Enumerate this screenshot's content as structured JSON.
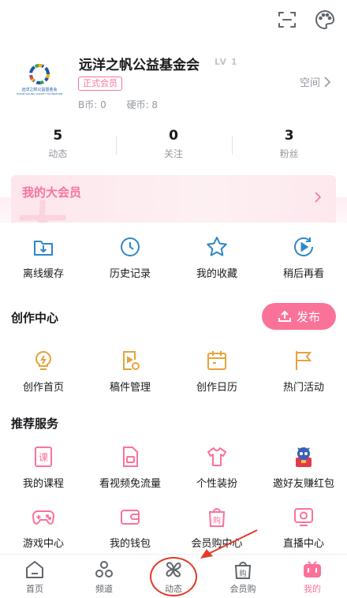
{
  "topbar": {
    "icons": [
      "scan-icon",
      "palette-icon"
    ]
  },
  "profile": {
    "name": "远洋之帆公益基金会",
    "level": "LV 1",
    "vip_badge": "正式会员",
    "b_coins": "B币: 0",
    "hard_coins": "硬币: 8",
    "space_label": "空间",
    "logo_text": "远洋之帆公益基金会",
    "logo_sub": "OCEAN SAILING CHARITY FOUNDATION"
  },
  "stats": [
    {
      "num": "5",
      "label": "动态"
    },
    {
      "num": "0",
      "label": "关注"
    },
    {
      "num": "3",
      "label": "粉丝"
    }
  ],
  "big_vip": {
    "title": "我的大会员",
    "watermark": "大"
  },
  "quick": [
    {
      "label": "离线缓存",
      "icon": "download-folder-icon"
    },
    {
      "label": "历史记录",
      "icon": "clock-icon"
    },
    {
      "label": "我的收藏",
      "icon": "star-icon"
    },
    {
      "label": "稍后再看",
      "icon": "watch-later-icon"
    }
  ],
  "creation": {
    "title": "创作中心",
    "publish_label": "发布",
    "items": [
      {
        "label": "创作首页",
        "icon": "lightbulb-icon"
      },
      {
        "label": "稿件管理",
        "icon": "manuscript-icon"
      },
      {
        "label": "创作日历",
        "icon": "calendar-icon"
      },
      {
        "label": "热门活动",
        "icon": "flag-icon"
      }
    ]
  },
  "services": {
    "title": "推荐服务",
    "row1": [
      {
        "label": "我的课程",
        "icon": "course-icon",
        "glyph": "课"
      },
      {
        "label": "看视频免流量",
        "icon": "sim-card-icon"
      },
      {
        "label": "个性装扮",
        "icon": "tshirt-icon"
      },
      {
        "label": "邀好友赚红包",
        "icon": "invite-mascot-icon"
      }
    ],
    "row2": [
      {
        "label": "游戏中心",
        "icon": "gamepad-icon"
      },
      {
        "label": "我的钱包",
        "icon": "wallet-icon"
      },
      {
        "label": "会员购中心",
        "icon": "shopping-bag-icon",
        "glyph": "购"
      },
      {
        "label": "直播中心",
        "icon": "live-tv-icon"
      }
    ]
  },
  "tabbar": [
    {
      "label": "首页",
      "icon": "home-icon"
    },
    {
      "label": "频道",
      "icon": "channel-icon"
    },
    {
      "label": "动态",
      "icon": "pinwheel-icon"
    },
    {
      "label": "会员购",
      "icon": "shopping-bag-icon",
      "glyph": "购"
    },
    {
      "label": "我的",
      "icon": "tv-mine-icon"
    }
  ],
  "colors": {
    "accent": "#fb7299",
    "blue": "#2e87c8",
    "yellow": "#e6a23c",
    "annotation": "#e23a2a"
  }
}
